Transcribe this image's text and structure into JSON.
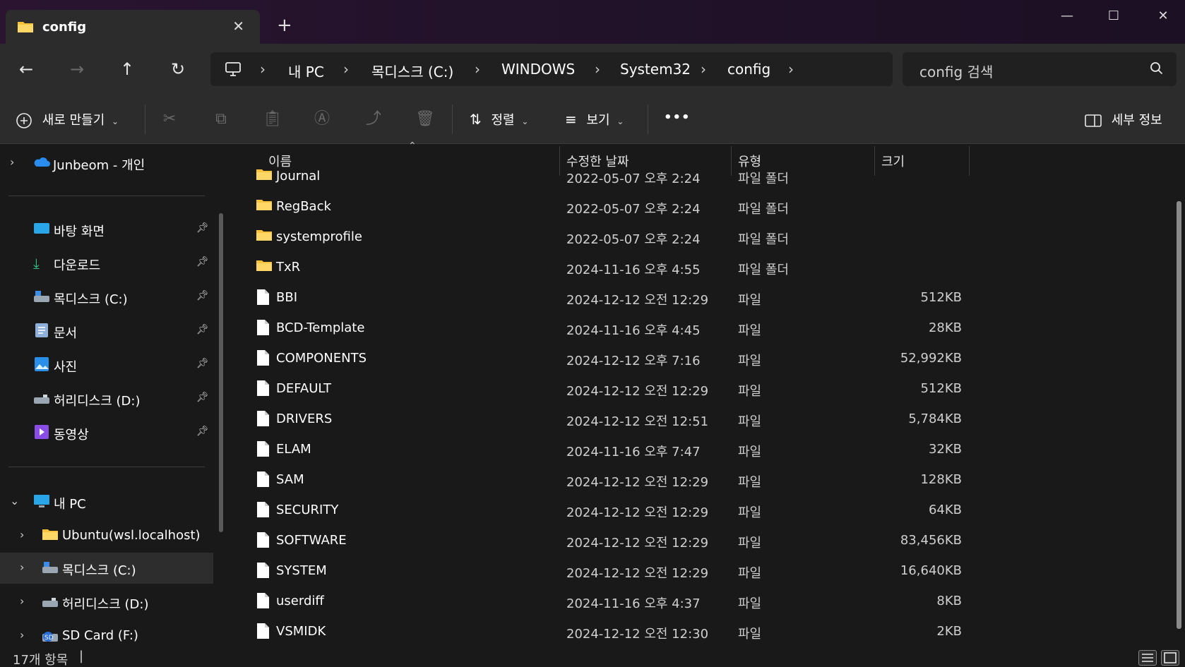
{
  "tab": {
    "title": "config",
    "close": "✕",
    "new_tab": "+"
  },
  "window_controls": {
    "minimize": "—",
    "maximize": "☐",
    "close": "✕"
  },
  "nav": {
    "back": "←",
    "forward": "→",
    "up": "↑",
    "refresh": "↻"
  },
  "breadcrumb": [
    "내 PC",
    "목디스크 (C:)",
    "WINDOWS",
    "System32",
    "config"
  ],
  "breadcrumb_sep": "›",
  "search": {
    "placeholder": "config 검색"
  },
  "toolbar": {
    "new_label": "새로 만들기",
    "sort_label": "정렬",
    "view_label": "보기",
    "more_label": "•••",
    "details_label": "세부 정보",
    "icons": [
      "cut-icon",
      "copy-icon",
      "paste-icon",
      "rename-icon",
      "share-icon",
      "delete-icon"
    ]
  },
  "sidebar": {
    "onedrive": "Junbeom - 개인",
    "quick_access": [
      {
        "label": "바탕 화면",
        "icon": "desktop-icon"
      },
      {
        "label": "다운로드",
        "icon": "download-icon"
      },
      {
        "label": "목디스크 (C:)",
        "icon": "drive-icon"
      },
      {
        "label": "문서",
        "icon": "documents-icon"
      },
      {
        "label": "사진",
        "icon": "pictures-icon"
      },
      {
        "label": "허리디스크 (D:)",
        "icon": "drive-icon"
      },
      {
        "label": "동영상",
        "icon": "videos-icon"
      }
    ],
    "this_pc": "내 PC",
    "pc_children": [
      {
        "label": "Ubuntu(wsl.localhost)",
        "icon": "folder-icon"
      },
      {
        "label": "목디스크 (C:)",
        "icon": "drive-icon"
      },
      {
        "label": "허리디스크 (D:)",
        "icon": "drive-icon"
      },
      {
        "label": "SD Card (F:)",
        "icon": "sdcard-icon"
      }
    ]
  },
  "columns": {
    "name": "이름",
    "modified": "수정한 날짜",
    "type": "유형",
    "size": "크기"
  },
  "files": [
    {
      "name": "Journal",
      "date": "2022-05-07 오후 2:24",
      "type": "파일 폴더",
      "size": "",
      "kind": "folder"
    },
    {
      "name": "RegBack",
      "date": "2022-05-07 오후 2:24",
      "type": "파일 폴더",
      "size": "",
      "kind": "folder"
    },
    {
      "name": "systemprofile",
      "date": "2022-05-07 오후 2:24",
      "type": "파일 폴더",
      "size": "",
      "kind": "folder"
    },
    {
      "name": "TxR",
      "date": "2024-11-16 오후 4:55",
      "type": "파일 폴더",
      "size": "",
      "kind": "folder"
    },
    {
      "name": "BBI",
      "date": "2024-12-12 오전 12:29",
      "type": "파일",
      "size": "512KB",
      "kind": "file"
    },
    {
      "name": "BCD-Template",
      "date": "2024-11-16 오후 4:45",
      "type": "파일",
      "size": "28KB",
      "kind": "file"
    },
    {
      "name": "COMPONENTS",
      "date": "2024-12-12 오후 7:16",
      "type": "파일",
      "size": "52,992KB",
      "kind": "file"
    },
    {
      "name": "DEFAULT",
      "date": "2024-12-12 오전 12:29",
      "type": "파일",
      "size": "512KB",
      "kind": "file"
    },
    {
      "name": "DRIVERS",
      "date": "2024-12-12 오전 12:51",
      "type": "파일",
      "size": "5,784KB",
      "kind": "file"
    },
    {
      "name": "ELAM",
      "date": "2024-11-16 오후 7:47",
      "type": "파일",
      "size": "32KB",
      "kind": "file"
    },
    {
      "name": "SAM",
      "date": "2024-12-12 오전 12:29",
      "type": "파일",
      "size": "128KB",
      "kind": "file"
    },
    {
      "name": "SECURITY",
      "date": "2024-12-12 오전 12:29",
      "type": "파일",
      "size": "64KB",
      "kind": "file"
    },
    {
      "name": "SOFTWARE",
      "date": "2024-12-12 오전 12:29",
      "type": "파일",
      "size": "83,456KB",
      "kind": "file"
    },
    {
      "name": "SYSTEM",
      "date": "2024-12-12 오전 12:29",
      "type": "파일",
      "size": "16,640KB",
      "kind": "file"
    },
    {
      "name": "userdiff",
      "date": "2024-11-16 오후 4:37",
      "type": "파일",
      "size": "8KB",
      "kind": "file"
    },
    {
      "name": "VSMIDK",
      "date": "2024-12-12 오전 12:30",
      "type": "파일",
      "size": "2KB",
      "kind": "file"
    }
  ],
  "status": {
    "count": "17개 항목"
  },
  "colors": {
    "folder": "#f8c33a",
    "accent": "#4cc2ff"
  }
}
